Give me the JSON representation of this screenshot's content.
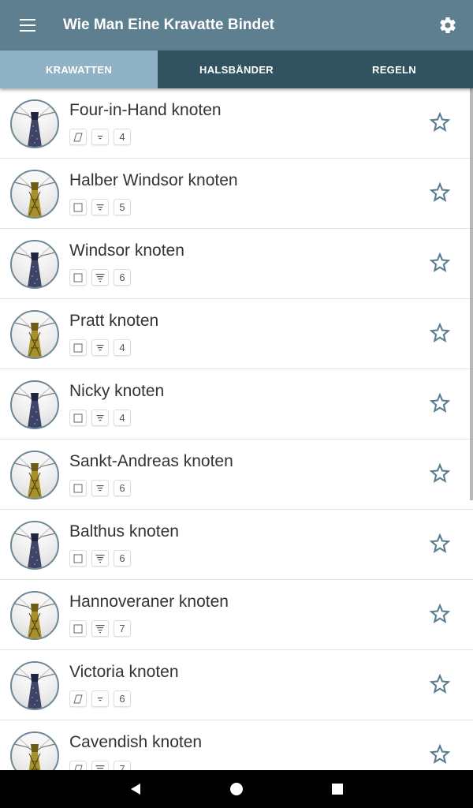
{
  "app": {
    "title": "Wie Man Eine Kravatte Bindet",
    "menu_icon": "hamburger-menu-icon",
    "settings_icon": "gear-icon"
  },
  "tabs": [
    {
      "label": "KRAWATTEN",
      "active": true
    },
    {
      "label": "HALSBÄNDER",
      "active": false
    },
    {
      "label": "REGELN",
      "active": false
    }
  ],
  "colors": {
    "appbar": "#5e7f8f",
    "tabbar": "#31525f",
    "active_tab": "#8fb3c5",
    "star_outline": "#5b7f90",
    "tie_blue": "#3d4466",
    "tie_gold": "#a8902c"
  },
  "knots": [
    {
      "name": "Four-in-Hand knoten",
      "symmetry": "asymmetric",
      "complexity": "low",
      "steps": "4",
      "tie": "blue"
    },
    {
      "name": "Halber Windsor knoten",
      "symmetry": "symmetric",
      "complexity": "medium",
      "steps": "5",
      "tie": "gold"
    },
    {
      "name": "Windsor knoten",
      "symmetry": "symmetric",
      "complexity": "high",
      "steps": "6",
      "tie": "blue"
    },
    {
      "name": "Pratt knoten",
      "symmetry": "symmetric",
      "complexity": "medium",
      "steps": "4",
      "tie": "gold"
    },
    {
      "name": "Nicky knoten",
      "symmetry": "symmetric",
      "complexity": "medium",
      "steps": "4",
      "tie": "blue"
    },
    {
      "name": "Sankt-Andreas knoten",
      "symmetry": "symmetric",
      "complexity": "medium",
      "steps": "6",
      "tie": "gold"
    },
    {
      "name": "Balthus knoten",
      "symmetry": "symmetric",
      "complexity": "high",
      "steps": "6",
      "tie": "blue"
    },
    {
      "name": "Hannoveraner knoten",
      "symmetry": "symmetric",
      "complexity": "high",
      "steps": "7",
      "tie": "gold"
    },
    {
      "name": "Victoria knoten",
      "symmetry": "asymmetric",
      "complexity": "low",
      "steps": "6",
      "tie": "blue"
    },
    {
      "name": "Cavendish knoten",
      "symmetry": "asymmetric",
      "complexity": "high",
      "steps": "7",
      "tie": "gold"
    }
  ],
  "navbar": {
    "back_icon": "back-triangle-icon",
    "home_icon": "home-circle-icon",
    "recents_icon": "recents-square-icon"
  }
}
